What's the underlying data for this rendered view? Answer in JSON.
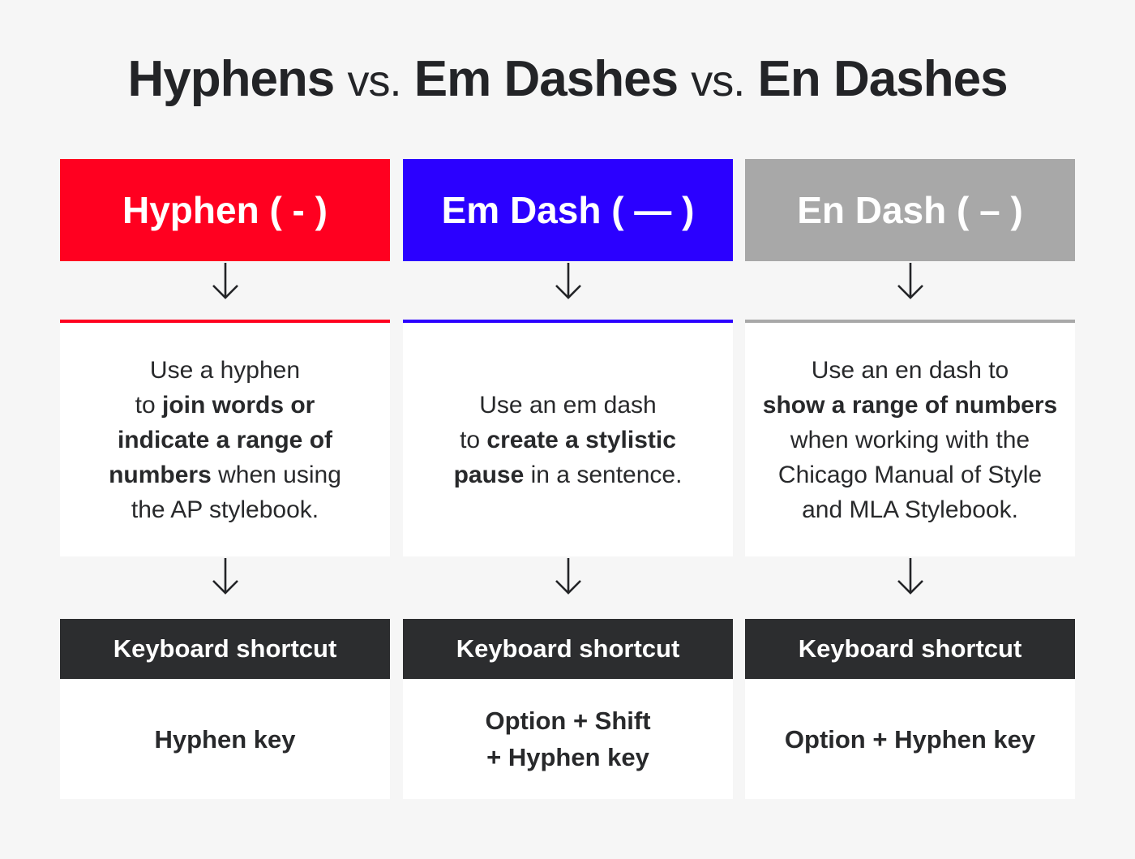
{
  "title": {
    "part1": "Hyphens",
    "vs1": "vs.",
    "part2": "Em Dashes",
    "vs2": "vs.",
    "part3": "En Dashes"
  },
  "colors": {
    "hyphen": "#ff0020",
    "em_dash": "#2b00ff",
    "en_dash": "#a8a8a8",
    "shortcut_header": "#2c2d2f",
    "background": "#f6f6f6"
  },
  "columns": [
    {
      "header": "Hyphen ( - )",
      "description": [
        {
          "text": "Use a hyphen",
          "bold": false,
          "br": true
        },
        {
          "text": "to ",
          "bold": false
        },
        {
          "text": "join words or",
          "bold": true,
          "br": true
        },
        {
          "text": "indicate a range of",
          "bold": true,
          "br": true
        },
        {
          "text": "numbers",
          "bold": true
        },
        {
          "text": " when using",
          "bold": false,
          "br": true
        },
        {
          "text": "the AP stylebook.",
          "bold": false
        }
      ],
      "shortcut_label": "Keyboard shortcut",
      "shortcut_lines": [
        "Hyphen key"
      ]
    },
    {
      "header": "Em Dash ( — )",
      "description": [
        {
          "text": "Use an em dash",
          "bold": false,
          "br": true
        },
        {
          "text": "to ",
          "bold": false
        },
        {
          "text": "create a stylistic",
          "bold": true,
          "br": true
        },
        {
          "text": "pause",
          "bold": true
        },
        {
          "text": " in a sentence.",
          "bold": false
        }
      ],
      "shortcut_label": "Keyboard shortcut",
      "shortcut_lines": [
        "Option + Shift",
        "+ Hyphen key"
      ]
    },
    {
      "header": "En Dash ( – )",
      "description": [
        {
          "text": "Use an en dash to",
          "bold": false,
          "br": true
        },
        {
          "text": "show a range of numbers",
          "bold": true,
          "br": true
        },
        {
          "text": "when working with the",
          "bold": false,
          "br": true
        },
        {
          "text": "Chicago Manual of Style",
          "bold": false,
          "br": true
        },
        {
          "text": "and MLA Stylebook.",
          "bold": false
        }
      ],
      "shortcut_label": "Keyboard shortcut",
      "shortcut_lines": [
        "Option + Hyphen key"
      ]
    }
  ]
}
